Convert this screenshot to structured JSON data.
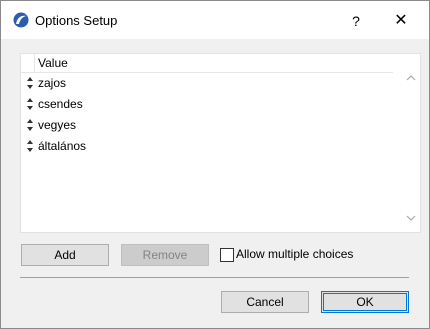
{
  "window": {
    "title": "Options Setup",
    "help_label": "?",
    "close_label": "✕"
  },
  "list": {
    "header": "Value",
    "items": [
      {
        "label": "zajos"
      },
      {
        "label": "csendes"
      },
      {
        "label": "vegyes"
      },
      {
        "label": "általános"
      }
    ],
    "scroll_up": "^",
    "scroll_down": "v"
  },
  "actions": {
    "add_label": "Add",
    "remove_label": "Remove",
    "allow_multiple_label": "Allow multiple choices",
    "allow_multiple_checked": false
  },
  "footer": {
    "cancel_label": "Cancel",
    "ok_label": "OK"
  },
  "colors": {
    "accent": "#0078d7",
    "app_icon": "#2a5db0"
  }
}
